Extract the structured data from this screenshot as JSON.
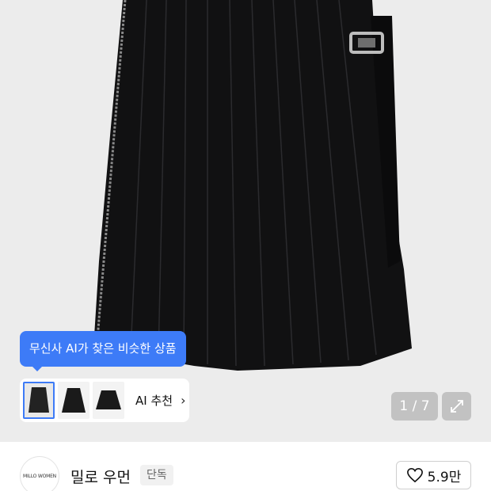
{
  "product_image": {
    "alt": "black pleated skirt",
    "counter": "1 / 7"
  },
  "ai_recommend": {
    "tooltip": "무신사 AI가 찾은 비슷한 상품",
    "label": "AI 추천",
    "accent_color": "#3d7bf7"
  },
  "brand": {
    "logo_text": "MILLO WOMEN",
    "name": "밀로 우먼",
    "badge": "단독"
  },
  "like": {
    "count": "5.9만",
    "icon": "heart-icon"
  }
}
